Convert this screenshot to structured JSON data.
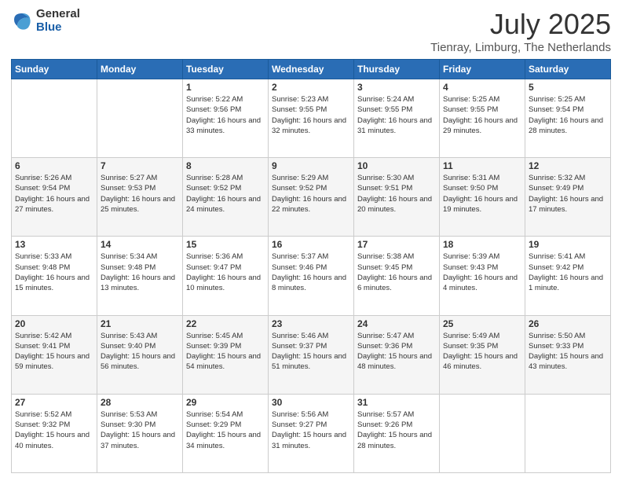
{
  "logo": {
    "general": "General",
    "blue": "Blue"
  },
  "header": {
    "month": "July 2025",
    "location": "Tienray, Limburg, The Netherlands"
  },
  "weekdays": [
    "Sunday",
    "Monday",
    "Tuesday",
    "Wednesday",
    "Thursday",
    "Friday",
    "Saturday"
  ],
  "weeks": [
    [
      {
        "day": "",
        "info": ""
      },
      {
        "day": "",
        "info": ""
      },
      {
        "day": "1",
        "info": "Sunrise: 5:22 AM\nSunset: 9:56 PM\nDaylight: 16 hours\nand 33 minutes."
      },
      {
        "day": "2",
        "info": "Sunrise: 5:23 AM\nSunset: 9:55 PM\nDaylight: 16 hours\nand 32 minutes."
      },
      {
        "day": "3",
        "info": "Sunrise: 5:24 AM\nSunset: 9:55 PM\nDaylight: 16 hours\nand 31 minutes."
      },
      {
        "day": "4",
        "info": "Sunrise: 5:25 AM\nSunset: 9:55 PM\nDaylight: 16 hours\nand 29 minutes."
      },
      {
        "day": "5",
        "info": "Sunrise: 5:25 AM\nSunset: 9:54 PM\nDaylight: 16 hours\nand 28 minutes."
      }
    ],
    [
      {
        "day": "6",
        "info": "Sunrise: 5:26 AM\nSunset: 9:54 PM\nDaylight: 16 hours\nand 27 minutes."
      },
      {
        "day": "7",
        "info": "Sunrise: 5:27 AM\nSunset: 9:53 PM\nDaylight: 16 hours\nand 25 minutes."
      },
      {
        "day": "8",
        "info": "Sunrise: 5:28 AM\nSunset: 9:52 PM\nDaylight: 16 hours\nand 24 minutes."
      },
      {
        "day": "9",
        "info": "Sunrise: 5:29 AM\nSunset: 9:52 PM\nDaylight: 16 hours\nand 22 minutes."
      },
      {
        "day": "10",
        "info": "Sunrise: 5:30 AM\nSunset: 9:51 PM\nDaylight: 16 hours\nand 20 minutes."
      },
      {
        "day": "11",
        "info": "Sunrise: 5:31 AM\nSunset: 9:50 PM\nDaylight: 16 hours\nand 19 minutes."
      },
      {
        "day": "12",
        "info": "Sunrise: 5:32 AM\nSunset: 9:49 PM\nDaylight: 16 hours\nand 17 minutes."
      }
    ],
    [
      {
        "day": "13",
        "info": "Sunrise: 5:33 AM\nSunset: 9:48 PM\nDaylight: 16 hours\nand 15 minutes."
      },
      {
        "day": "14",
        "info": "Sunrise: 5:34 AM\nSunset: 9:48 PM\nDaylight: 16 hours\nand 13 minutes."
      },
      {
        "day": "15",
        "info": "Sunrise: 5:36 AM\nSunset: 9:47 PM\nDaylight: 16 hours\nand 10 minutes."
      },
      {
        "day": "16",
        "info": "Sunrise: 5:37 AM\nSunset: 9:46 PM\nDaylight: 16 hours\nand 8 minutes."
      },
      {
        "day": "17",
        "info": "Sunrise: 5:38 AM\nSunset: 9:45 PM\nDaylight: 16 hours\nand 6 minutes."
      },
      {
        "day": "18",
        "info": "Sunrise: 5:39 AM\nSunset: 9:43 PM\nDaylight: 16 hours\nand 4 minutes."
      },
      {
        "day": "19",
        "info": "Sunrise: 5:41 AM\nSunset: 9:42 PM\nDaylight: 16 hours\nand 1 minute."
      }
    ],
    [
      {
        "day": "20",
        "info": "Sunrise: 5:42 AM\nSunset: 9:41 PM\nDaylight: 15 hours\nand 59 minutes."
      },
      {
        "day": "21",
        "info": "Sunrise: 5:43 AM\nSunset: 9:40 PM\nDaylight: 15 hours\nand 56 minutes."
      },
      {
        "day": "22",
        "info": "Sunrise: 5:45 AM\nSunset: 9:39 PM\nDaylight: 15 hours\nand 54 minutes."
      },
      {
        "day": "23",
        "info": "Sunrise: 5:46 AM\nSunset: 9:37 PM\nDaylight: 15 hours\nand 51 minutes."
      },
      {
        "day": "24",
        "info": "Sunrise: 5:47 AM\nSunset: 9:36 PM\nDaylight: 15 hours\nand 48 minutes."
      },
      {
        "day": "25",
        "info": "Sunrise: 5:49 AM\nSunset: 9:35 PM\nDaylight: 15 hours\nand 46 minutes."
      },
      {
        "day": "26",
        "info": "Sunrise: 5:50 AM\nSunset: 9:33 PM\nDaylight: 15 hours\nand 43 minutes."
      }
    ],
    [
      {
        "day": "27",
        "info": "Sunrise: 5:52 AM\nSunset: 9:32 PM\nDaylight: 15 hours\nand 40 minutes."
      },
      {
        "day": "28",
        "info": "Sunrise: 5:53 AM\nSunset: 9:30 PM\nDaylight: 15 hours\nand 37 minutes."
      },
      {
        "day": "29",
        "info": "Sunrise: 5:54 AM\nSunset: 9:29 PM\nDaylight: 15 hours\nand 34 minutes."
      },
      {
        "day": "30",
        "info": "Sunrise: 5:56 AM\nSunset: 9:27 PM\nDaylight: 15 hours\nand 31 minutes."
      },
      {
        "day": "31",
        "info": "Sunrise: 5:57 AM\nSunset: 9:26 PM\nDaylight: 15 hours\nand 28 minutes."
      },
      {
        "day": "",
        "info": ""
      },
      {
        "day": "",
        "info": ""
      }
    ]
  ]
}
